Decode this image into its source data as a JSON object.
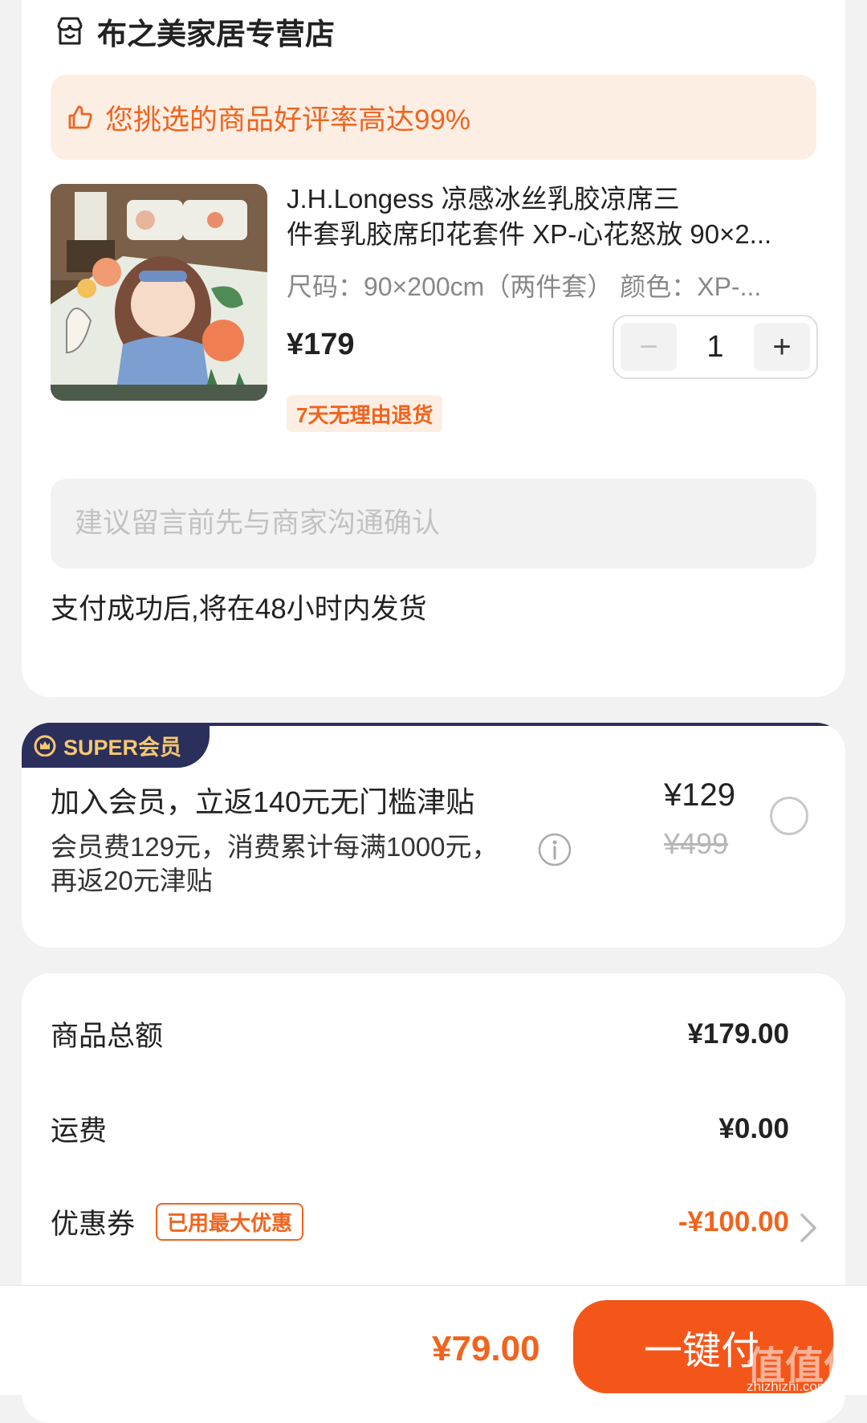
{
  "store": {
    "icon": "store-icon",
    "name": "布之美家居专营店",
    "rating_banner": "您挑选的商品好评率高达99%"
  },
  "product": {
    "title_line1": "J.H.Longess 凉感冰丝乳胶凉席三",
    "title_line2": "件套乳胶席印花套件 XP-心花怒放 90×2...",
    "spec": "尺码：90×200cm（两件套）  颜色：XP-...",
    "price": "¥179",
    "quantity": "1",
    "minus_label": "−",
    "plus_label": "+",
    "return_tag": "7天无理由退货"
  },
  "message": {
    "placeholder": "建议留言前先与商家沟通确认"
  },
  "shipping_note": "支付成功后,将在48小时内发货",
  "member": {
    "badge": "SUPER会员",
    "title": "加入会员，立返140元无门槛津贴",
    "desc": "会员费129元，消费累计每满1000元，再返20元津贴",
    "price": "¥129",
    "original_price": "¥499"
  },
  "summary": {
    "goods_label": "商品总额",
    "goods_value": "¥179.00",
    "shipping_label": "运费",
    "shipping_value": "¥0.00",
    "coupon_label": "优惠券",
    "coupon_tag": "已用最大优惠",
    "coupon_value": "-¥100.00"
  },
  "bottom": {
    "total": "¥79.00",
    "pay_label": "一键付",
    "watermark": "值值值",
    "watermark_url": "zhizhizhi.com"
  },
  "colors": {
    "accent": "#f0641e",
    "pay_button": "#f4561a",
    "banner_bg": "#fdeee4",
    "member_navy": "#2b2f5c",
    "member_gold": "#f5c870"
  }
}
